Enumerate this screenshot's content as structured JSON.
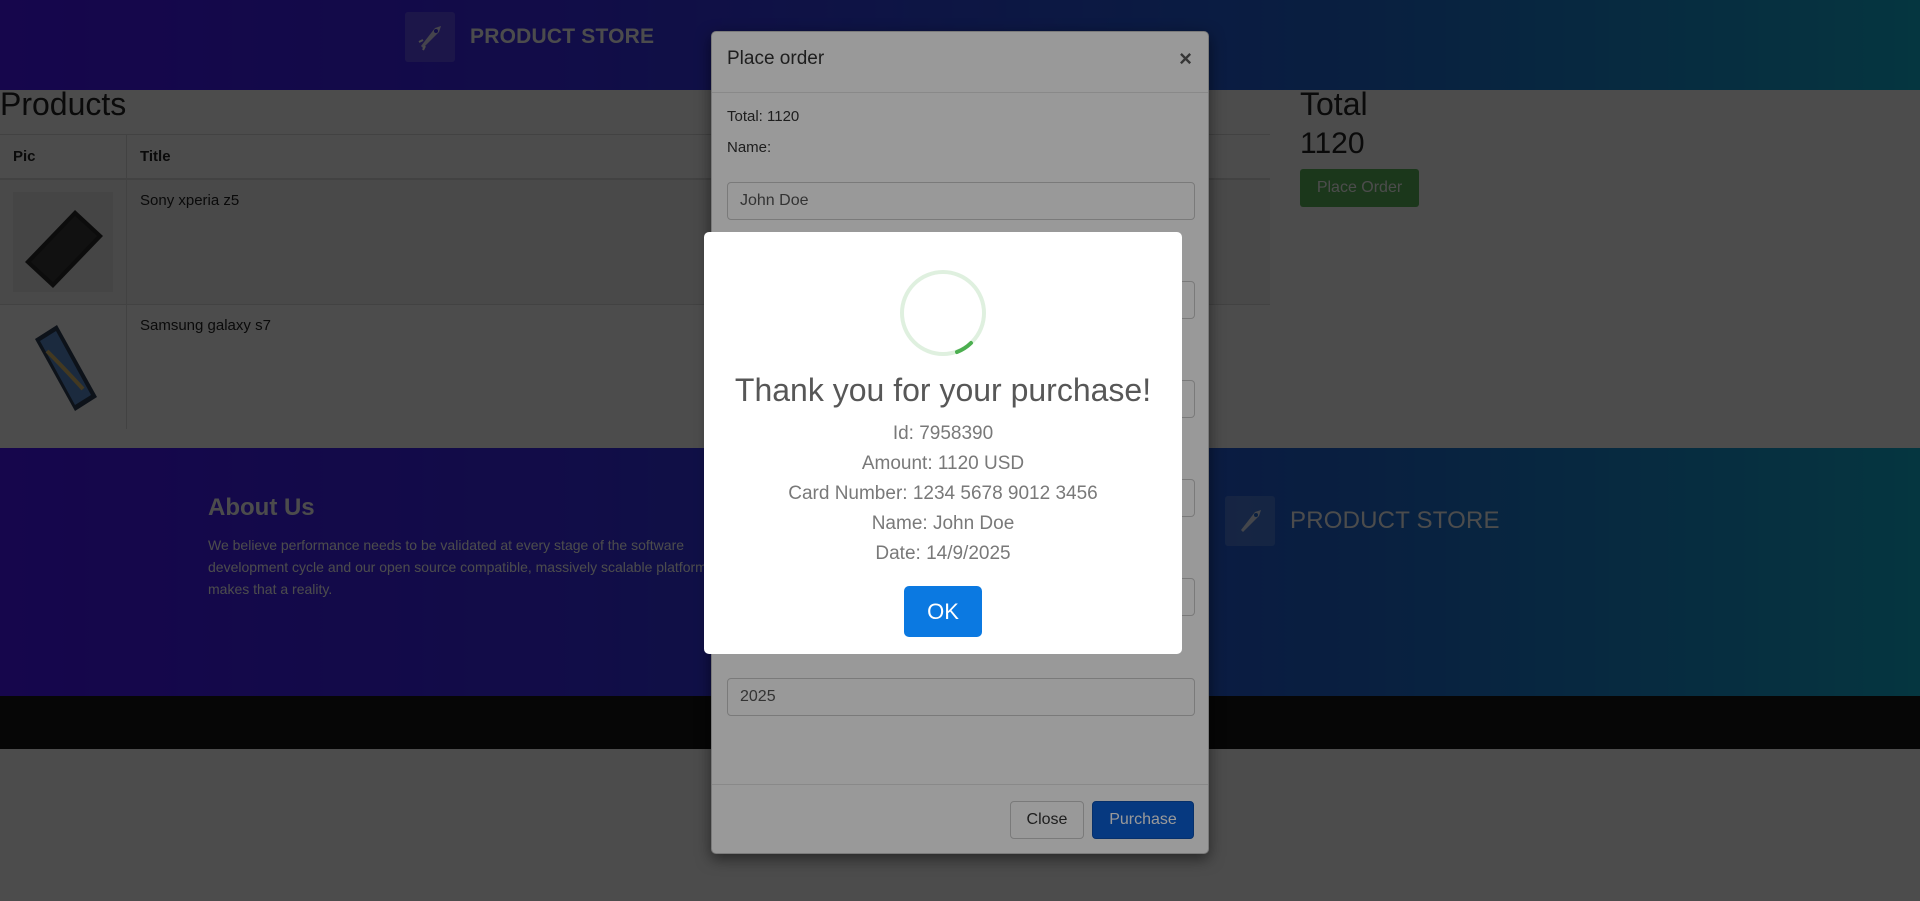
{
  "header": {
    "brand": "PRODUCT STORE"
  },
  "products": {
    "title": "Products",
    "columns": [
      "Pic",
      "Title"
    ],
    "rows": [
      {
        "title": "Sony xperia z5"
      },
      {
        "title": "Samsung galaxy s7"
      }
    ]
  },
  "total": {
    "label": "Total",
    "value": "1120",
    "place_order_label": "Place Order"
  },
  "footer": {
    "about_title": "About Us",
    "about_text": "We believe performance needs to be validated at every stage of the software development cycle and our open source compatible, massively scalable platform makes that a reality.",
    "brand": "PRODUCT STORE"
  },
  "modal": {
    "title": "Place order",
    "close_x": "×",
    "total_line": "Total: 1120",
    "name_label": "Name:",
    "name_value": "John Doe",
    "year_value": "2025",
    "close_label": "Close",
    "purchase_label": "Purchase"
  },
  "alert": {
    "title": "Thank you for your purchase!",
    "id_line": "Id: 7958390",
    "amount_line": "Amount: 1120 USD",
    "card_line": "Card Number: 1234 5678 9012 3456",
    "name_line": "Name: John Doe",
    "date_line": "Date: 14/9/2025",
    "ok_label": "OK"
  },
  "colors": {
    "nav_gradient_start": "#4a14ff",
    "nav_gradient_end": "#12b5d6",
    "success": "#5cb85c",
    "primary": "#0b79e1"
  }
}
